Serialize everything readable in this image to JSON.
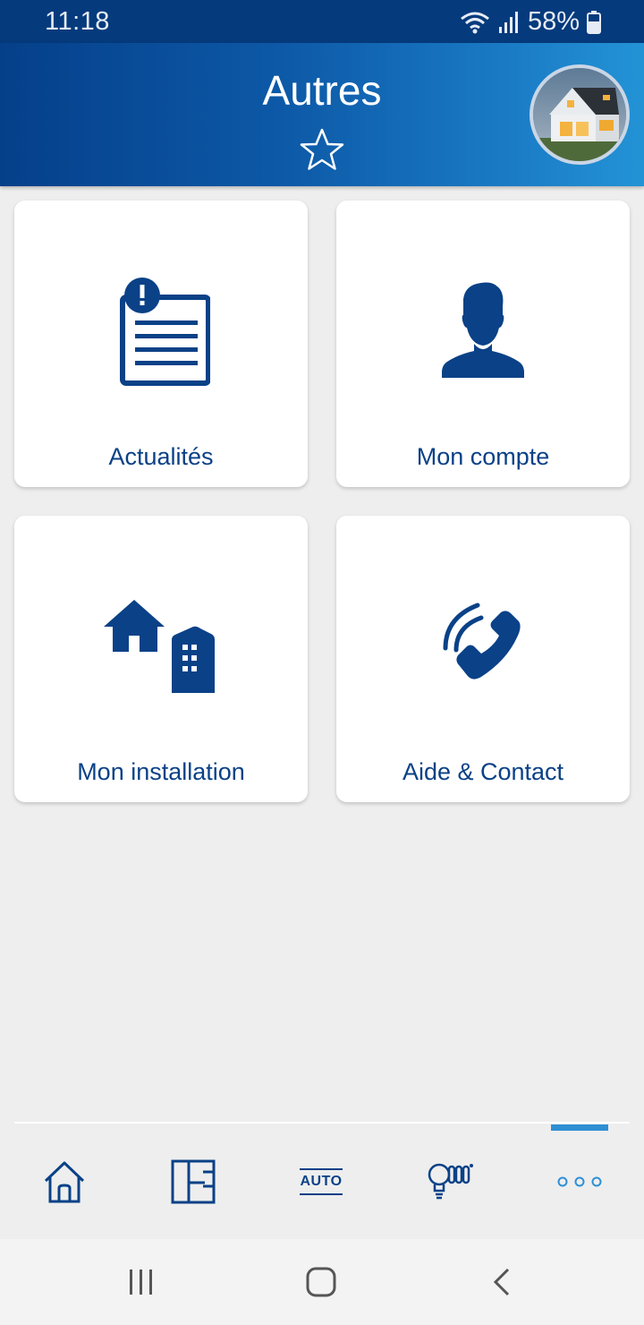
{
  "status_bar": {
    "time": "11:18",
    "battery": "58%"
  },
  "header": {
    "title": "Autres"
  },
  "tiles": [
    {
      "label": "Actualités",
      "icon": "news-alert-icon"
    },
    {
      "label": "Mon compte",
      "icon": "user-icon"
    },
    {
      "label": "Mon installation",
      "icon": "installation-icon"
    },
    {
      "label": "Aide & Contact",
      "icon": "phone-icon"
    }
  ],
  "bottom_nav": {
    "items": [
      "home-icon",
      "floor-plan-icon",
      "auto-icon",
      "lighting-icon",
      "more-icon"
    ],
    "auto_label": "AUTO",
    "active": "more-icon"
  },
  "colors": {
    "primary": "#0a4187",
    "header_start": "#053f8a",
    "header_end": "#2393d6",
    "accent": "#2f8fd4"
  }
}
